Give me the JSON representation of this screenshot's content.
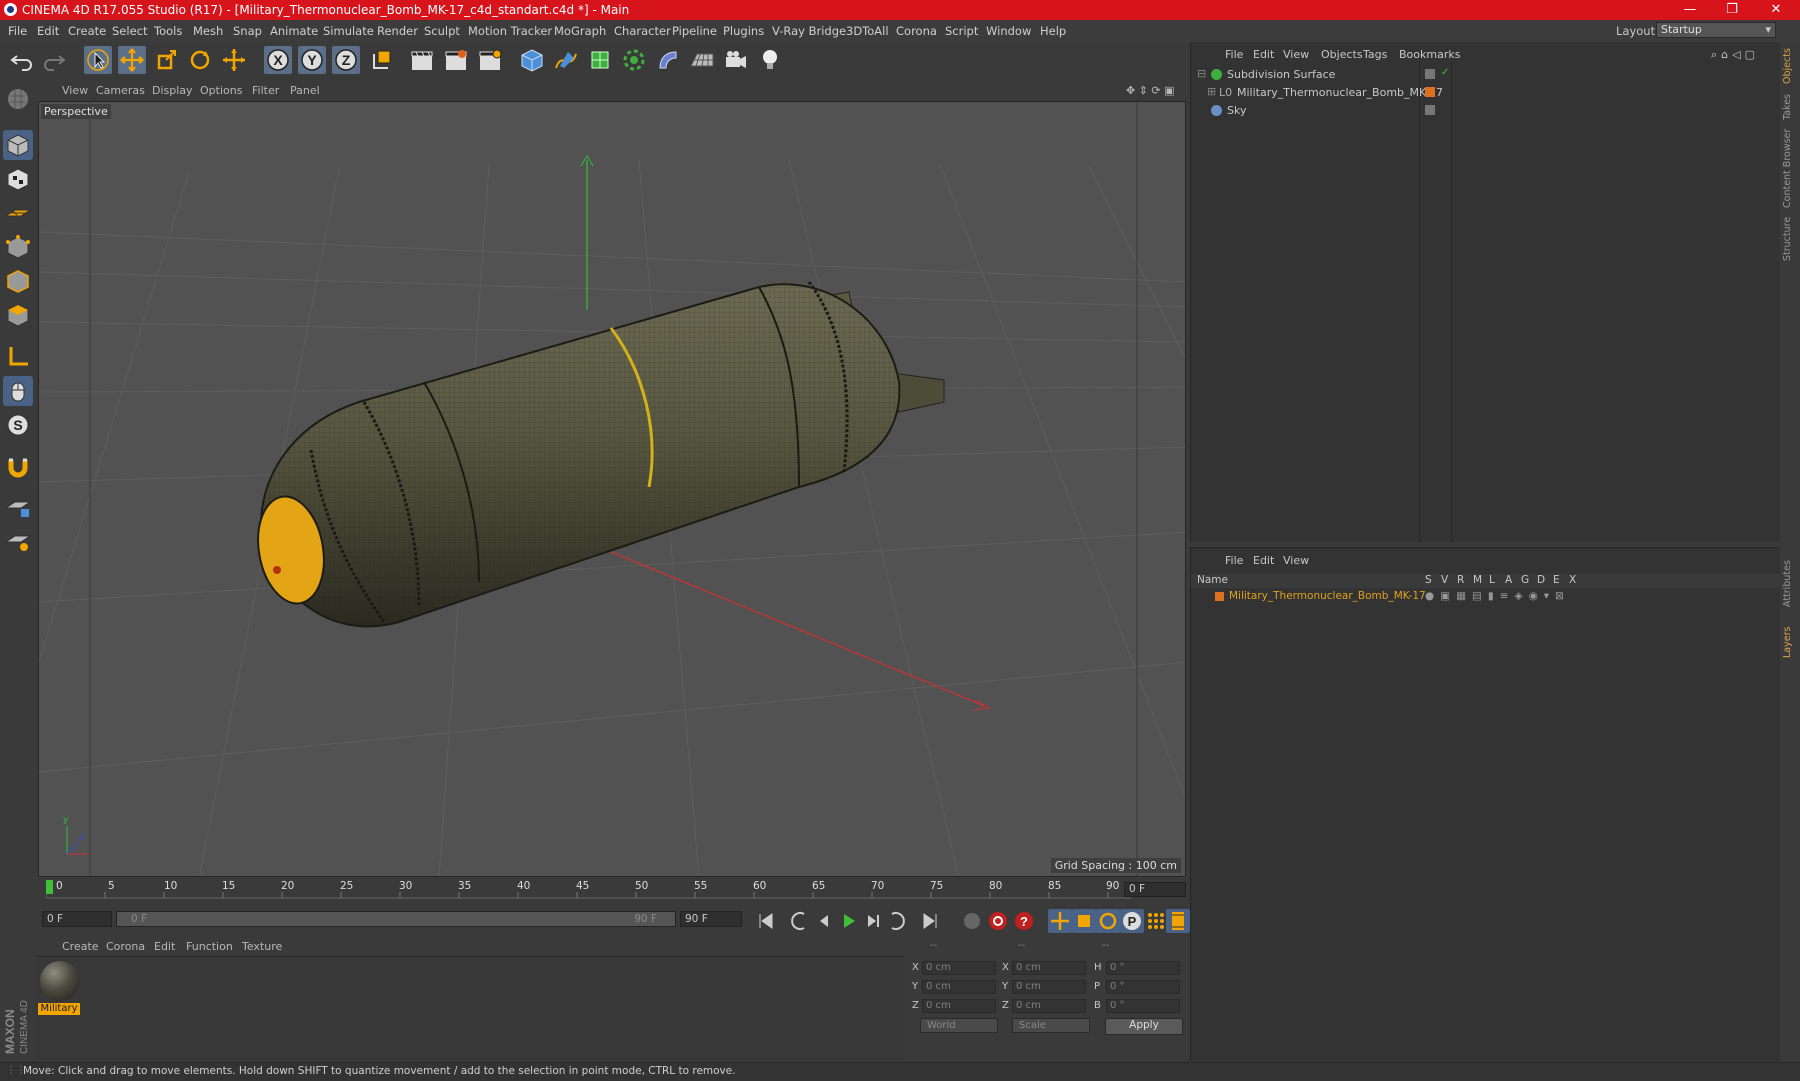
{
  "window": {
    "title": "CINEMA 4D R17.055 Studio (R17) - [Military_Thermonuclear_Bomb_MK-17_c4d_standart.c4d *] - Main",
    "controls": [
      "—",
      "❐",
      "✕"
    ]
  },
  "menubar": {
    "items": [
      "File",
      "Edit",
      "Create",
      "Select",
      "Tools",
      "Mesh",
      "Snap",
      "Animate",
      "Simulate",
      "Render",
      "Sculpt",
      "Motion Tracker",
      "MoGraph",
      "Character",
      "Pipeline",
      "Plugins",
      "V-Ray Bridge",
      "3DToAll",
      "Corona",
      "Script",
      "Window",
      "Help"
    ],
    "layout_label": "Layout:",
    "layout_value": "Startup"
  },
  "viewport": {
    "menu": [
      "View",
      "Cameras",
      "Display",
      "Options",
      "Filter",
      "Panel"
    ],
    "label": "Perspective",
    "grid_spacing": "Grid Spacing : 100 cm"
  },
  "timeline": {
    "ticks": [
      "0",
      "5",
      "10",
      "15",
      "20",
      "25",
      "30",
      "35",
      "40",
      "45",
      "50",
      "55",
      "60",
      "65",
      "70",
      "75",
      "80",
      "85",
      "90"
    ],
    "current_frame": "0 F"
  },
  "transport": {
    "start_field": "0 F",
    "range_start": "0 F",
    "range_end": "90 F",
    "end_field": "90 F"
  },
  "material_manager": {
    "menu": [
      "Create",
      "Corona",
      "Edit",
      "Function",
      "Texture"
    ],
    "materials": [
      {
        "name": "Military"
      }
    ]
  },
  "coordinates": {
    "headers": [
      "--",
      "--",
      "--"
    ],
    "rows": [
      {
        "a1": "X",
        "v1": "0 cm",
        "a2": "X",
        "v2": "0 cm",
        "a3": "H",
        "v3": "0 °"
      },
      {
        "a1": "Y",
        "v1": "0 cm",
        "a2": "Y",
        "v2": "0 cm",
        "a3": "P",
        "v3": "0 °"
      },
      {
        "a1": "Z",
        "v1": "0 cm",
        "a2": "Z",
        "v2": "0 cm",
        "a3": "B",
        "v3": "0 °"
      }
    ],
    "mode_world": "World",
    "mode_scale": "Scale",
    "apply": "Apply"
  },
  "object_manager": {
    "menu": [
      "File",
      "Edit",
      "View",
      "Objects",
      "Tags",
      "Bookmarks"
    ],
    "objects": [
      {
        "name": "Subdivision Surface",
        "indent": 0,
        "icon": "subdivision-icon"
      },
      {
        "name": "Military_Thermonuclear_Bomb_MK-17",
        "indent": 1,
        "icon": "null-object-icon"
      },
      {
        "name": "Sky",
        "indent": 0,
        "icon": "sky-icon"
      }
    ]
  },
  "layer_manager": {
    "menu": [
      "File",
      "Edit",
      "View"
    ],
    "columns": [
      "Name",
      "S",
      "V",
      "R",
      "M",
      "L",
      "A",
      "G",
      "D",
      "E",
      "X"
    ],
    "layers": [
      {
        "name": "Military_Thermonuclear_Bomb_MK-17",
        "color": "#e07020"
      }
    ]
  },
  "side_tabs": [
    "Objects",
    "Takes",
    "Content Browser",
    "Structure",
    "Attributes",
    "Layers"
  ],
  "status": "Move: Click and drag to move elements. Hold down SHIFT to quantize movement / add to the selection in point mode, CTRL to remove.",
  "brand": "MAXON CINEMA 4D",
  "colors": {
    "accent": "#d7141c",
    "selection": "#f0a500",
    "axis_x": "#d03030",
    "axis_y": "#30c030",
    "axis_z": "#3050d0"
  }
}
